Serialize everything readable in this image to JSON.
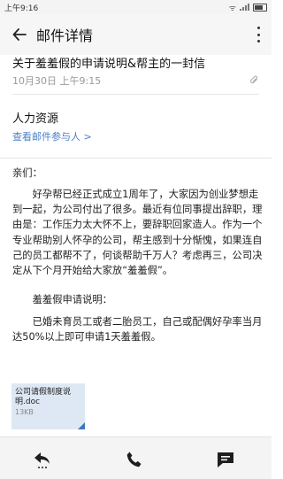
{
  "status_bar": {
    "time": "上午9:16",
    "wifi_glyph": "ᯤ"
  },
  "app_bar": {
    "title": "邮件详情",
    "back_icon": "arrow-left-icon",
    "more_icon": "more-vertical-icon"
  },
  "mail": {
    "subject": "关于羞羞假的申请说明&帮主的一封信",
    "date": "10月30日 上午9:15",
    "sender": "人力资源",
    "participants_link": "查看邮件参与人 >",
    "greeting": "亲们：",
    "paragraph_main": "好孕帮已经正式成立1周年了，大家因为创业梦想走到一起，为公司付出了很多。最近有位同事提出辞职，理由是：工作压力太大怀不上，要辞职回家造人。作为一个专业帮助别人怀孕的公司，帮主感到十分惭愧，如果连自己的员工都帮不了，何谈帮助千万人？考虑再三，公司决定从下个月开始给大家放“羞羞假”。",
    "paragraph_subheading": "羞羞假申请说明：",
    "paragraph_rule": "已婚未育员工或者二胎员工，自己或配偶好孕率当月达50%以上即可申请1天羞羞假。"
  },
  "attachment": {
    "name": "公司请假制度说明.doc",
    "size": "13KB",
    "accent_color": "#3a78c2"
  },
  "bottom_bar": {
    "reply_icon": "reply-icon",
    "call_icon": "phone-icon",
    "chat_icon": "chat-icon"
  }
}
